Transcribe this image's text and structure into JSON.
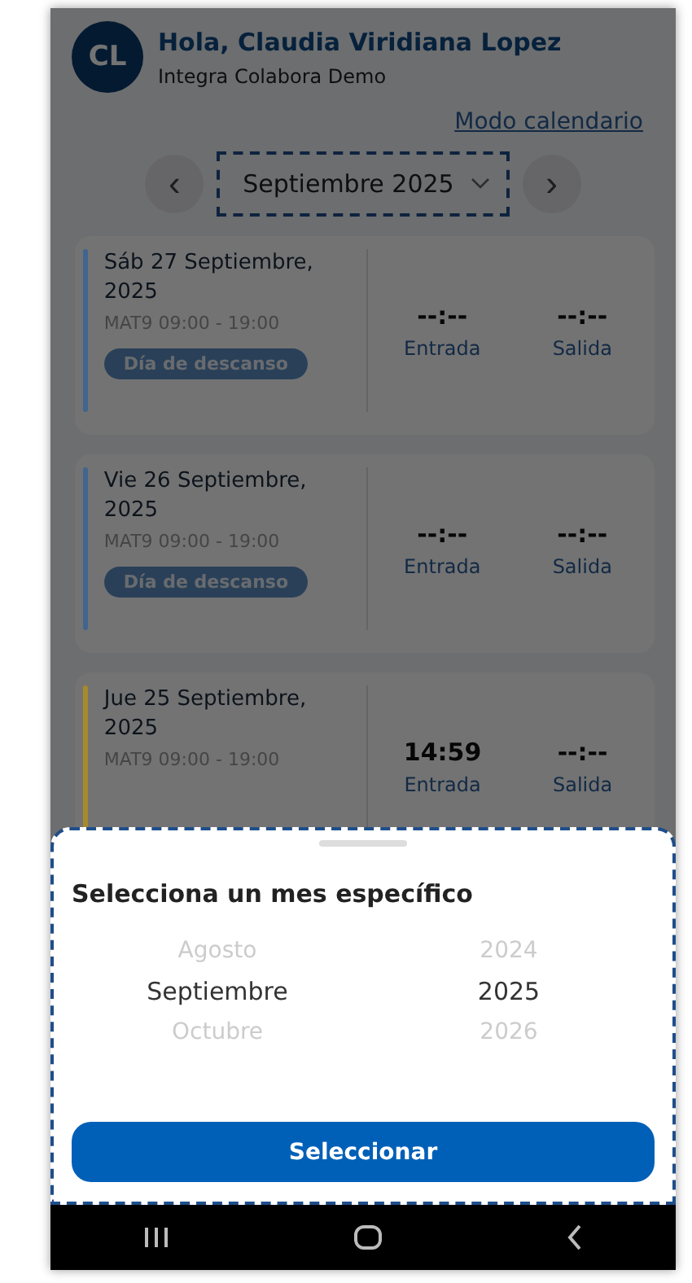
{
  "header": {
    "avatar": "CL",
    "greeting": "Hola, Claudia Viridiana Lopez",
    "company": "Integra Colabora Demo"
  },
  "calendar_link": "Modo calendario",
  "month_selector": {
    "prev": "‹",
    "label": "Septiembre 2025",
    "next": "›",
    "highlighted": true
  },
  "days": [
    {
      "color": "#3f6590",
      "date": "Sáb 27 Septiembre, 2025",
      "shift": "MAT9 09:00 - 19:00",
      "badge": "Día de descanso",
      "entry_time": "--:--",
      "entry_label": "Entrada",
      "exit_time": "--:--",
      "exit_label": "Salida"
    },
    {
      "color": "#3f6590",
      "date": "Vie 26 Septiembre, 2025",
      "shift": "MAT9 09:00 - 19:00",
      "badge": "Día de descanso",
      "entry_time": "--:--",
      "entry_label": "Entrada",
      "exit_time": "--:--",
      "exit_label": "Salida"
    },
    {
      "color": "#a88a2a",
      "date": "Jue 25 Septiembre, 2025",
      "shift": "MAT9 09:00 - 19:00",
      "entry_time": "14:59",
      "entry_label": "Entrada",
      "exit_time": "--:--",
      "exit_label": "Salida"
    }
  ],
  "sheet": {
    "title": "Selecciona un mes específico",
    "highlighted": true,
    "months": [
      {
        "label": "Agosto",
        "selected": false
      },
      {
        "label": "Septiembre",
        "selected": true
      },
      {
        "label": "Octubre",
        "selected": false
      }
    ],
    "years": [
      {
        "label": "2024",
        "selected": false
      },
      {
        "label": "2025",
        "selected": true
      },
      {
        "label": "2026",
        "selected": false
      }
    ],
    "button": "Seleccionar"
  }
}
